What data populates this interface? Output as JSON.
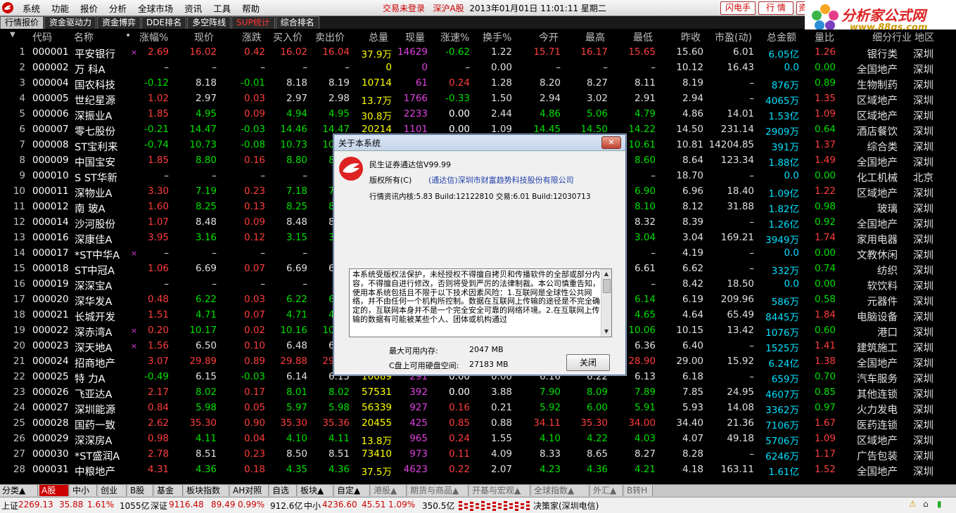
{
  "menu": {
    "items": [
      "系统",
      "功能",
      "报价",
      "分析",
      "全球市场",
      "资讯",
      "工具",
      "帮助"
    ]
  },
  "status_msg": "交易未登录",
  "market": "深沪A股",
  "datetime": "2013年01月01日  11:01:11  星期二",
  "buttons": {
    "flash": "闪电手",
    "quote": "行 情",
    "info": "资"
  },
  "brand": {
    "title": "分析家公式网",
    "url": "www.88gs.com"
  },
  "tabs": [
    "行情报价",
    "资金驱动力",
    "资金博弈",
    "DDE排名",
    "多空阵线",
    "SUP统计",
    "综合排名"
  ],
  "headers": [
    "代码",
    "名称",
    "•",
    "涨幅%",
    "现价",
    "涨跌",
    "买入价",
    "卖出价",
    "总量",
    "现量",
    "涨速%",
    "换手%",
    "今开",
    "最高",
    "最低",
    "昨收",
    "市盈(动)",
    "总金额",
    "量比",
    "细分行业",
    "地区"
  ],
  "rows": [
    [
      "1",
      "000001",
      "平安银行",
      "×",
      "2.69",
      "16.02",
      "0.42",
      "16.02",
      "16.04",
      "37.9万",
      "14629",
      "-0.62",
      "1.22",
      "15.71",
      "16.17",
      "15.65",
      "15.60",
      "6.01",
      "6.05亿",
      "1.26",
      "银行类",
      "深圳"
    ],
    [
      "2",
      "000002",
      "万  科A",
      "",
      "–",
      "–",
      "–",
      "–",
      "–",
      "0",
      "0",
      "–",
      "0.00",
      "–",
      "–",
      "–",
      "10.12",
      "16.43",
      "0.0",
      "0.00",
      "全国地产",
      "深圳"
    ],
    [
      "3",
      "000004",
      "国农科技",
      "",
      "-0.12",
      "8.18",
      "-0.01",
      "8.18",
      "8.19",
      "10714",
      "61",
      "0.24",
      "1.28",
      "8.20",
      "8.27",
      "8.11",
      "8.19",
      "–",
      "876万",
      "0.89",
      "生物制药",
      "深圳"
    ],
    [
      "4",
      "000005",
      "世纪星源",
      "",
      "1.02",
      "2.97",
      "0.03",
      "2.97",
      "2.98",
      "13.7万",
      "1766",
      "-0.33",
      "1.50",
      "2.94",
      "3.02",
      "2.91",
      "2.94",
      "–",
      "4065万",
      "1.35",
      "区域地产",
      "深圳"
    ],
    [
      "5",
      "000006",
      "深振业A",
      "",
      "1.85",
      "4.95",
      "0.09",
      "4.94",
      "4.95",
      "30.8万",
      "2233",
      "0.00",
      "2.44",
      "4.86",
      "5.06",
      "4.79",
      "4.86",
      "14.01",
      "1.53亿",
      "1.09",
      "区域地产",
      "深圳"
    ],
    [
      "6",
      "000007",
      "零七股份",
      "",
      "-0.21",
      "14.47",
      "-0.03",
      "14.46",
      "14.47",
      "20214",
      "1101",
      "0.00",
      "1.09",
      "14.45",
      "14.50",
      "14.22",
      "14.50",
      "231.14",
      "2909万",
      "0.64",
      "酒店餐饮",
      "深圳"
    ],
    [
      "7",
      "000008",
      "ST宝利来",
      "",
      "-0.74",
      "10.73",
      "-0.08",
      "10.73",
      "10.74",
      "",
      "",
      "",
      "",
      "",
      "",
      "10.61",
      "10.81",
      "14204.85",
      "391万",
      "1.37",
      "综合类",
      "深圳"
    ],
    [
      "8",
      "000009",
      "中国宝安",
      "",
      "1.85",
      "8.80",
      "0.16",
      "8.80",
      "8.81",
      "",
      "",
      "",
      "",
      "",
      "",
      "8.60",
      "8.64",
      "123.34",
      "1.88亿",
      "1.49",
      "全国地产",
      "深圳"
    ],
    [
      "9",
      "000010",
      "S ST华新",
      "",
      "–",
      "–",
      "–",
      "–",
      "–",
      "",
      "",
      "",
      "",
      "",
      "",
      "–",
      "18.70",
      "–",
      "0.0",
      "0.00",
      "化工机械",
      "北京"
    ],
    [
      "10",
      "000011",
      "深物业A",
      "",
      "3.30",
      "7.19",
      "0.23",
      "7.18",
      "7.19",
      "",
      "",
      "",
      "",
      "",
      "",
      "6.90",
      "6.96",
      "18.40",
      "1.09亿",
      "1.22",
      "区域地产",
      "深圳"
    ],
    [
      "11",
      "000012",
      "南  玻A",
      "",
      "1.60",
      "8.25",
      "0.13",
      "8.25",
      "8.26",
      "",
      "",
      "",
      "",
      "",
      "",
      "8.10",
      "8.12",
      "31.88",
      "1.82亿",
      "0.98",
      "玻璃",
      "深圳"
    ],
    [
      "12",
      "000014",
      "沙河股份",
      "",
      "1.07",
      "8.48",
      "0.09",
      "8.48",
      "8.49",
      "",
      "",
      "",
      "",
      "",
      "",
      "8.32",
      "8.39",
      "–",
      "1.26亿",
      "0.92",
      "全国地产",
      "深圳"
    ],
    [
      "13",
      "000016",
      "深康佳A",
      "",
      "3.95",
      "3.16",
      "0.12",
      "3.15",
      "3.16",
      "",
      "",
      "",
      "",
      "",
      "",
      "3.04",
      "3.04",
      "169.21",
      "3949万",
      "1.74",
      "家用电器",
      "深圳"
    ],
    [
      "14",
      "000017",
      "*ST中华A",
      "×",
      "–",
      "–",
      "–",
      "–",
      "–",
      "",
      "",
      "",
      "",
      "",
      "",
      "–",
      "4.19",
      "–",
      "0.0",
      "0.00",
      "文教休闲",
      "深圳"
    ],
    [
      "15",
      "000018",
      "ST中冠A",
      "",
      "1.06",
      "6.69",
      "0.07",
      "6.69",
      "6.70",
      "",
      "",
      "",
      "",
      "",
      "",
      "6.61",
      "6.62",
      "–",
      "332万",
      "0.74",
      "纺织",
      "深圳"
    ],
    [
      "16",
      "000019",
      "深深宝A",
      "",
      "–",
      "–",
      "–",
      "–",
      "–",
      "",
      "",
      "",
      "",
      "",
      "",
      "–",
      "8.42",
      "18.50",
      "0.0",
      "0.00",
      "软饮料",
      "深圳"
    ],
    [
      "17",
      "000020",
      "深华发A",
      "",
      "0.48",
      "6.22",
      "0.03",
      "6.22",
      "6.23",
      "",
      "",
      "",
      "",
      "",
      "",
      "6.14",
      "6.19",
      "209.96",
      "586万",
      "0.58",
      "元器件",
      "深圳"
    ],
    [
      "18",
      "000021",
      "长城开发",
      "",
      "1.51",
      "4.71",
      "0.07",
      "4.71",
      "4.72",
      "",
      "",
      "",
      "",
      "",
      "",
      "4.65",
      "4.64",
      "65.49",
      "8445万",
      "1.84",
      "电脑设备",
      "深圳"
    ],
    [
      "19",
      "000022",
      "深赤湾A",
      "×",
      "0.20",
      "10.17",
      "0.02",
      "10.16",
      "10.17",
      "",
      "",
      "",
      "",
      "",
      "",
      "10.06",
      "10.15",
      "13.42",
      "1076万",
      "0.60",
      "港口",
      "深圳"
    ],
    [
      "20",
      "000023",
      "深天地A",
      "×",
      "1.56",
      "6.50",
      "0.10",
      "6.48",
      "6.50",
      "",
      "",
      "",
      "",
      "",
      "",
      "6.36",
      "6.40",
      "–",
      "1525万",
      "1.41",
      "建筑施工",
      "深圳"
    ],
    [
      "21",
      "000024",
      "招商地产",
      "",
      "3.07",
      "29.89",
      "0.89",
      "29.88",
      "29.89",
      "",
      "",
      "",
      "",
      "",
      "",
      "28.90",
      "29.00",
      "15.92",
      "6.24亿",
      "1.38",
      "全国地产",
      "深圳"
    ],
    [
      "22",
      "000025",
      "特  力A",
      "",
      "-0.49",
      "6.15",
      "-0.03",
      "6.14",
      "6.15",
      "10089",
      "291",
      "0.00",
      "0.00",
      "6.16",
      "6.22",
      "6.13",
      "6.18",
      "–",
      "659万",
      "0.70",
      "汽车服务",
      "深圳"
    ],
    [
      "23",
      "000026",
      "飞亚达A",
      "",
      "2.17",
      "8.02",
      "0.17",
      "8.01",
      "8.02",
      "57531",
      "392",
      "0.00",
      "3.88",
      "7.90",
      "8.09",
      "7.89",
      "7.85",
      "24.95",
      "4607万",
      "0.85",
      "其他连锁",
      "深圳"
    ],
    [
      "24",
      "000027",
      "深圳能源",
      "",
      "0.84",
      "5.98",
      "0.05",
      "5.97",
      "5.98",
      "56339",
      "927",
      "0.16",
      "0.21",
      "5.92",
      "6.00",
      "5.91",
      "5.93",
      "14.08",
      "3362万",
      "0.97",
      "火力发电",
      "深圳"
    ],
    [
      "25",
      "000028",
      "国药一致",
      "",
      "2.62",
      "35.30",
      "0.90",
      "35.30",
      "35.36",
      "20455",
      "425",
      "0.85",
      "0.88",
      "34.11",
      "35.30",
      "34.00",
      "34.40",
      "21.36",
      "7106万",
      "1.67",
      "医药连锁",
      "深圳"
    ],
    [
      "26",
      "000029",
      "深深房A",
      "",
      "0.98",
      "4.11",
      "0.04",
      "4.10",
      "4.11",
      "13.8万",
      "965",
      "0.24",
      "1.55",
      "4.10",
      "4.22",
      "4.03",
      "4.07",
      "49.18",
      "5706万",
      "1.09",
      "区域地产",
      "深圳"
    ],
    [
      "27",
      "000030",
      "*ST盛润A",
      "",
      "2.78",
      "8.51",
      "0.23",
      "8.50",
      "8.51",
      "73410",
      "973",
      "0.11",
      "4.09",
      "8.33",
      "8.65",
      "8.27",
      "8.28",
      "–",
      "6246万",
      "1.17",
      "广告包装",
      "深圳"
    ],
    [
      "28",
      "000031",
      "中粮地产",
      "",
      "4.31",
      "4.36",
      "0.18",
      "4.35",
      "4.36",
      "37.5万",
      "4623",
      "0.22",
      "2.07",
      "4.23",
      "4.36",
      "4.21",
      "4.18",
      "163.11",
      "1.61亿",
      "1.52",
      "全国地产",
      "深圳"
    ]
  ],
  "dialog": {
    "title": "关于本系统",
    "close_x": "✕",
    "product": "民生证券通达信V99.99",
    "copyright_label": "版权所有(C)",
    "company": "(通达信)深圳市财富趋势科技股份有限公司",
    "kernel": "行情资讯内核:5.83 Build:12122810 交易:6.01 Build:12030713",
    "legal": "本系统受版权法保护，未经授权不得擅自拷贝和传播软件的全部或部分内容，不得擅自进行修改，否则将受到严厉的法律制裁。本公司慎重告知，使用本系统包括且不限于以下技术因素风险：1.互联网是全球性公共网络，并不由任何一个机构所控制。数据在互联网上传输的途径是不完全确定的，互联网本身并不是一个完全安全可靠的网络环境。2.在互联网上传输的数据有可能被某些个人、团体或机构通过",
    "mem_label": "最大可用内存:",
    "mem_value": "2047 MB",
    "disk_label": "C盘上可用硬盘空间:",
    "disk_value": "27183 MB",
    "close_button": "关闭"
  },
  "categories": [
    "分类▲",
    "A股",
    "中小",
    "创业",
    "B股",
    "基金",
    "板块指数",
    "AH对照",
    "自选",
    "板块▲",
    "自定▲",
    "港股▲",
    "期货与商品▲",
    "开基与宏观▲",
    "全球指数▲",
    "外汇▲",
    "B转H"
  ],
  "statusbar": {
    "sh_label": "上证",
    "sh_value": "2269.13",
    "sh_change": "35.88",
    "sh_pct": "1.61%",
    "sh_amount": "1055亿",
    "sz_label": "深证",
    "sz_value": "9116.48",
    "sz_change": "89.49",
    "sz_pct": "0.99%",
    "sz_amount": "912.6亿",
    "zx_label": "中小",
    "zx_value": "4236.60",
    "zx_change": "45.51",
    "zx_pct": "1.09%",
    "zx_amount": "350.5亿",
    "server": "决策家(深圳电信)"
  }
}
